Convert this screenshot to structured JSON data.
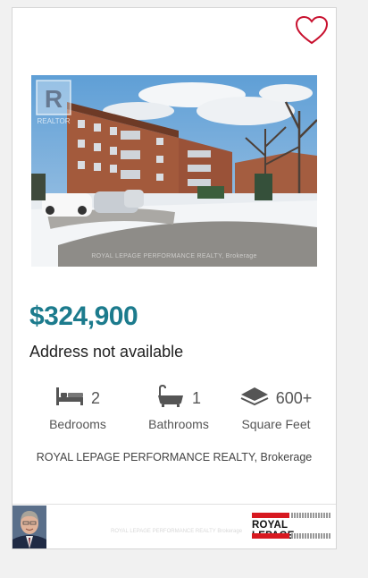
{
  "listing": {
    "price": "$324,900",
    "address": "Address not available",
    "photo_watermark": "ROYAL LEPAGE PERFORMANCE REALTY, Brokerage",
    "photo_logo_text": "REALTOR",
    "features": [
      {
        "value": "2",
        "label": "Bedrooms",
        "icon": "bed-icon"
      },
      {
        "value": "1",
        "label": "Bathrooms",
        "icon": "bathtub-icon"
      },
      {
        "value": "600+",
        "label": "Square Feet",
        "icon": "area-layers-icon"
      }
    ],
    "brokerage": "ROYAL LEPAGE PERFORMANCE REALTY, Brokerage"
  },
  "footer": {
    "faint_text": "ROYAL LEPAGE PERFORMANCE REALTY Brokerage",
    "brand_logo_text": "ROYAL LEPAGE"
  },
  "colors": {
    "price": "#1c7b8d",
    "heart": "#c8102e",
    "brand_red": "#d71920",
    "background": "#f1f1f1"
  }
}
